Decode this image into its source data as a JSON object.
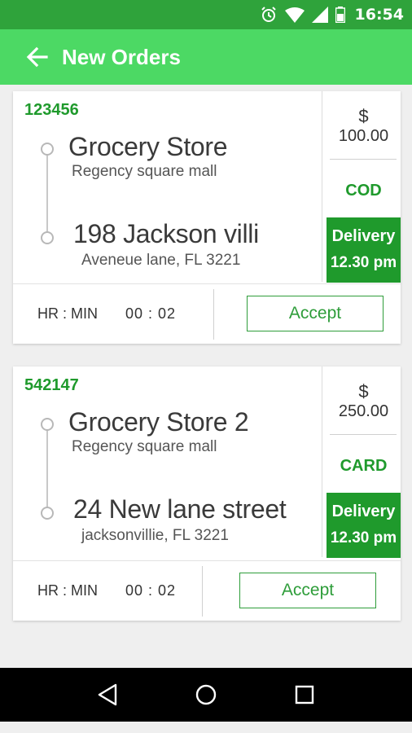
{
  "status_bar": {
    "time": "16:54",
    "icons": [
      "alarm-icon",
      "wifi-icon",
      "signal-icon",
      "battery-icon"
    ]
  },
  "app_bar": {
    "title": "New Orders",
    "back_icon": "arrow-left-icon"
  },
  "orders": [
    {
      "order_id": "123456",
      "pickup_name": "Grocery Store",
      "pickup_location": "Regency square mall",
      "drop_address": "198 Jackson villi",
      "drop_location": "Aveneue lane, FL 3221",
      "currency": "$",
      "price": "100.00",
      "payment_method": "COD",
      "delivery_label": "Delivery",
      "delivery_time": "12.30 pm",
      "timer_label": "HR : MIN",
      "timer_value": "00 : 02",
      "accept_label": "Accept"
    },
    {
      "order_id": "542147",
      "pickup_name": "Grocery Store 2",
      "pickup_location": "Regency square mall",
      "drop_address": "24 New lane street",
      "drop_location": "jacksonvillie, FL 3221",
      "currency": "$",
      "price": "250.00",
      "payment_method": "CARD",
      "delivery_label": "Delivery",
      "delivery_time": "12.30 pm",
      "timer_label": "HR : MIN",
      "timer_value": "00 : 02",
      "accept_label": "Accept"
    }
  ],
  "nav_bar": {
    "buttons": [
      "back-triangle-icon",
      "home-circle-icon",
      "recents-square-icon"
    ]
  },
  "colors": {
    "status_bar": "#2fa33b",
    "app_bar": "#4cd964",
    "accent_green": "#1f9a2c",
    "background": "#efefef"
  }
}
